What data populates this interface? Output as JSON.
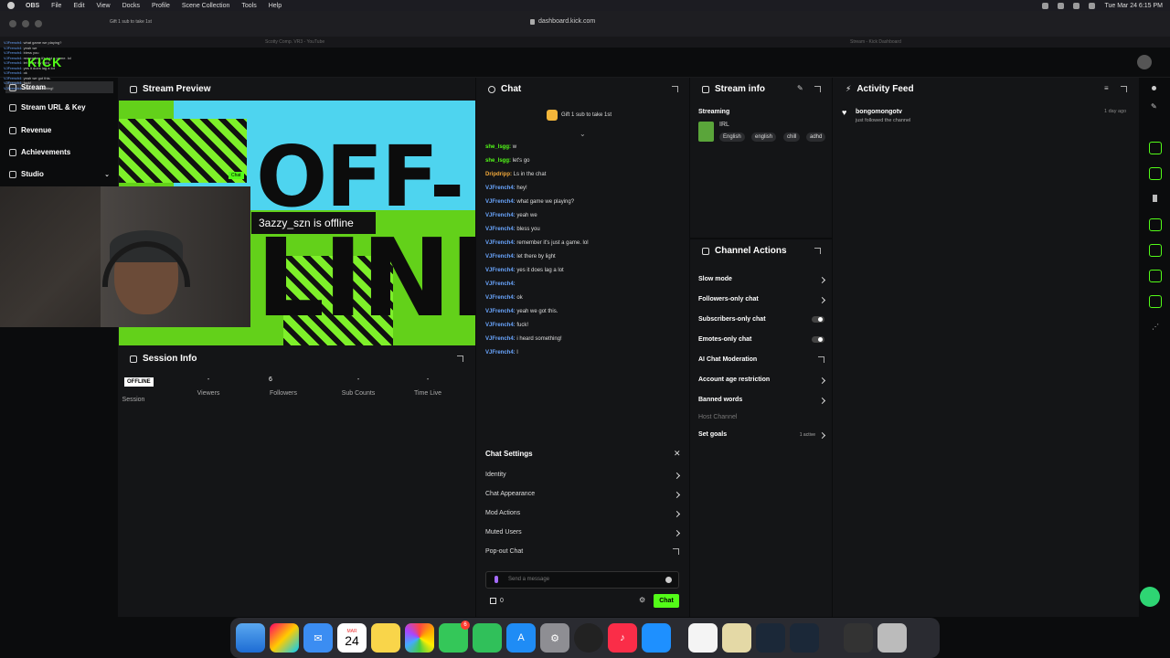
{
  "menubar": {
    "items": [
      "OBS",
      "File",
      "Edit",
      "View",
      "Docks",
      "Profile",
      "Scene Collection",
      "Tools",
      "Help"
    ],
    "clock": "Tue Mar 24  6:15 PM"
  },
  "browser": {
    "url": "dashboard.kick.com",
    "tabs": [
      "Scotty Comp. VR3 - YouTube",
      "Stream - Kick Dashboard"
    ],
    "small_tab": "Gift 1 sub to take 1st"
  },
  "brand": {
    "logo": "KICK",
    "accent": "#53fc18"
  },
  "obs_chat": [
    {
      "user": "VJFrench4:",
      "text": "what game we playing?"
    },
    {
      "user": "VJFrench4:",
      "text": "yeah we"
    },
    {
      "user": "VJFrench4:",
      "text": "bless you"
    },
    {
      "user": "VJFrench4:",
      "text": "remember it's just a game. lol"
    },
    {
      "user": "VJFrench4:",
      "text": "let there by light"
    },
    {
      "user": "VJFrench4:",
      "text": "yes it does lag a lot"
    },
    {
      "user": "VJFrench4:",
      "text": "ok"
    },
    {
      "user": "VJFrench4:",
      "text": "yeah we got this."
    },
    {
      "user": "VJFrench4:",
      "text": "fuck!"
    },
    {
      "user": "VJFrench4:",
      "text": "i heard something!"
    }
  ],
  "sidebar": {
    "items": [
      {
        "label": "Stream",
        "icon": "stream-icon"
      },
      {
        "label": "Stream URL & Key",
        "icon": "key-icon"
      },
      {
        "label": "Revenue",
        "icon": "dollar-icon"
      },
      {
        "label": "Achievements",
        "icon": "trophy-icon"
      },
      {
        "label": "Studio",
        "icon": "studio-icon"
      }
    ]
  },
  "preview": {
    "title": "Stream Preview",
    "big_text_top": "OFF",
    "big_text_dash": "-",
    "big_text_bottom": "LINE",
    "offline_message": "3azzy_szn is offline",
    "mini_badge": "Chat"
  },
  "session": {
    "title": "Session Info",
    "badge": "OFFLINE",
    "session_label": "Session",
    "stats": [
      {
        "value": "-",
        "label": "Viewers"
      },
      {
        "value": "6",
        "label": "Followers"
      },
      {
        "value": "-",
        "label": "Sub Counts"
      },
      {
        "value": "-",
        "label": "Time Live"
      }
    ]
  },
  "chat": {
    "title": "Chat",
    "gift_text": "Gift 1 sub to take 1st",
    "messages": [
      {
        "user": "she_lsgg:",
        "text": "w",
        "color": "#53fc18"
      },
      {
        "user": "she_lsgg:",
        "text": "let's go",
        "color": "#53fc18"
      },
      {
        "user": "Dripdripp:",
        "text": "Ls in the chat",
        "color": "#f2a93b"
      },
      {
        "user": "VJFrench4:",
        "text": "hey!",
        "color": "#6aa6ff"
      },
      {
        "user": "VJFrench4:",
        "text": "what game we playing?",
        "color": "#6aa6ff"
      },
      {
        "user": "VJFrench4:",
        "text": "yeah we",
        "color": "#6aa6ff"
      },
      {
        "user": "VJFrench4:",
        "text": "bless you",
        "color": "#6aa6ff"
      },
      {
        "user": "VJFrench4:",
        "text": "remember it's just a game. lol",
        "color": "#6aa6ff"
      },
      {
        "user": "VJFrench4:",
        "text": "let there by light",
        "color": "#6aa6ff"
      },
      {
        "user": "VJFrench4:",
        "text": "yes it does lag a lot",
        "color": "#6aa6ff"
      },
      {
        "user": "VJFrench4:",
        "text": "",
        "color": "#6aa6ff"
      },
      {
        "user": "VJFrench4:",
        "text": "ok",
        "color": "#6aa6ff"
      },
      {
        "user": "VJFrench4:",
        "text": "yeah we got this.",
        "color": "#6aa6ff"
      },
      {
        "user": "VJFrench4:",
        "text": "fuck!",
        "color": "#6aa6ff"
      },
      {
        "user": "VJFrench4:",
        "text": "i heard something!",
        "color": "#6aa6ff"
      },
      {
        "user": "VJFrench4:",
        "text": "l",
        "color": "#6aa6ff"
      }
    ],
    "settings_title": "Chat Settings",
    "settings": [
      "Identity",
      "Chat Appearance",
      "Mod Actions",
      "Muted Users",
      "Pop-out Chat"
    ],
    "input_placeholder": "Send a message",
    "points": "0",
    "send_label": "Chat"
  },
  "stream_info": {
    "title": "Stream info",
    "status": "Streaming",
    "category": "IRL",
    "tags": [
      "English",
      "english",
      "chill",
      "adhd"
    ]
  },
  "channel_actions": {
    "title": "Channel Actions",
    "items": [
      {
        "label": "Slow mode",
        "control": "chevron"
      },
      {
        "label": "Followers-only chat",
        "control": "chevron"
      },
      {
        "label": "Subscribers-only chat",
        "control": "toggle"
      },
      {
        "label": "Emotes-only chat",
        "control": "toggle"
      },
      {
        "label": "AI Chat Moderation",
        "control": "external"
      },
      {
        "label": "Account age restriction",
        "control": "chevron"
      },
      {
        "label": "Banned words",
        "control": "chevron"
      },
      {
        "label": "Host Channel",
        "control": "none"
      },
      {
        "label": "Set goals",
        "control": "chevron",
        "badge": "1 active"
      }
    ]
  },
  "activity": {
    "title": "Activity Feed",
    "items": [
      {
        "user": "bongomongotv",
        "text": "just followed the channel",
        "time": "1 day ago"
      }
    ]
  },
  "dock": {
    "apps": [
      "finder-icon",
      "launchpad-icon",
      "mail-icon",
      "calendar-icon",
      "notes-icon",
      "photos-icon",
      "messages-icon",
      "facetime-icon",
      "appstore-icon",
      "settings-icon",
      "obs-icon",
      "music-icon",
      "safari-icon",
      "reminders-icon",
      "chatgpt-icon",
      "steam-icon",
      "steam-alt-icon"
    ],
    "calendar_month": "MAR",
    "calendar_day": "24",
    "messages_badge": "6"
  }
}
